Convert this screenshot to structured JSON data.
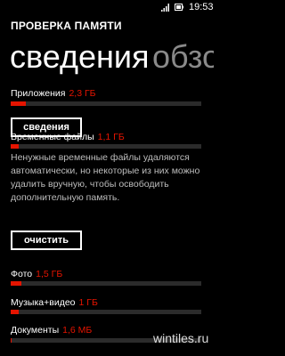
{
  "status_bar": {
    "time": "19:53",
    "signal_icon": "signal-icon",
    "battery_icon": "battery-icon"
  },
  "app_title": "ПРОВЕРКА ПАМЯТИ",
  "pivot": {
    "active": "сведения",
    "next_partial": "обзо"
  },
  "apps": {
    "label": "Приложения",
    "value": "2,3 ГБ",
    "fraction": 0.08
  },
  "details_button": "сведения",
  "temp": {
    "label": "Временные файлы",
    "value": "1,1 ГБ",
    "fraction": 0.04,
    "description": "Ненужные временные файлы удаляются автоматически, но некоторые из них можно удалить вручную, чтобы освободить дополнительную память."
  },
  "clear_button": "очистить",
  "photo": {
    "label": "Фото",
    "value": "1,5 ГБ",
    "fraction": 0.055
  },
  "music": {
    "label": "Музыка+видео",
    "value": "1 ГБ",
    "fraction": 0.04
  },
  "docs": {
    "label": "Документы",
    "value": "1,6 МБ",
    "fraction": 0.005
  },
  "watermark": "wintiles.ru",
  "colors": {
    "accent": "#e51400",
    "background": "#000000",
    "bar_track": "#2b2b2b"
  }
}
